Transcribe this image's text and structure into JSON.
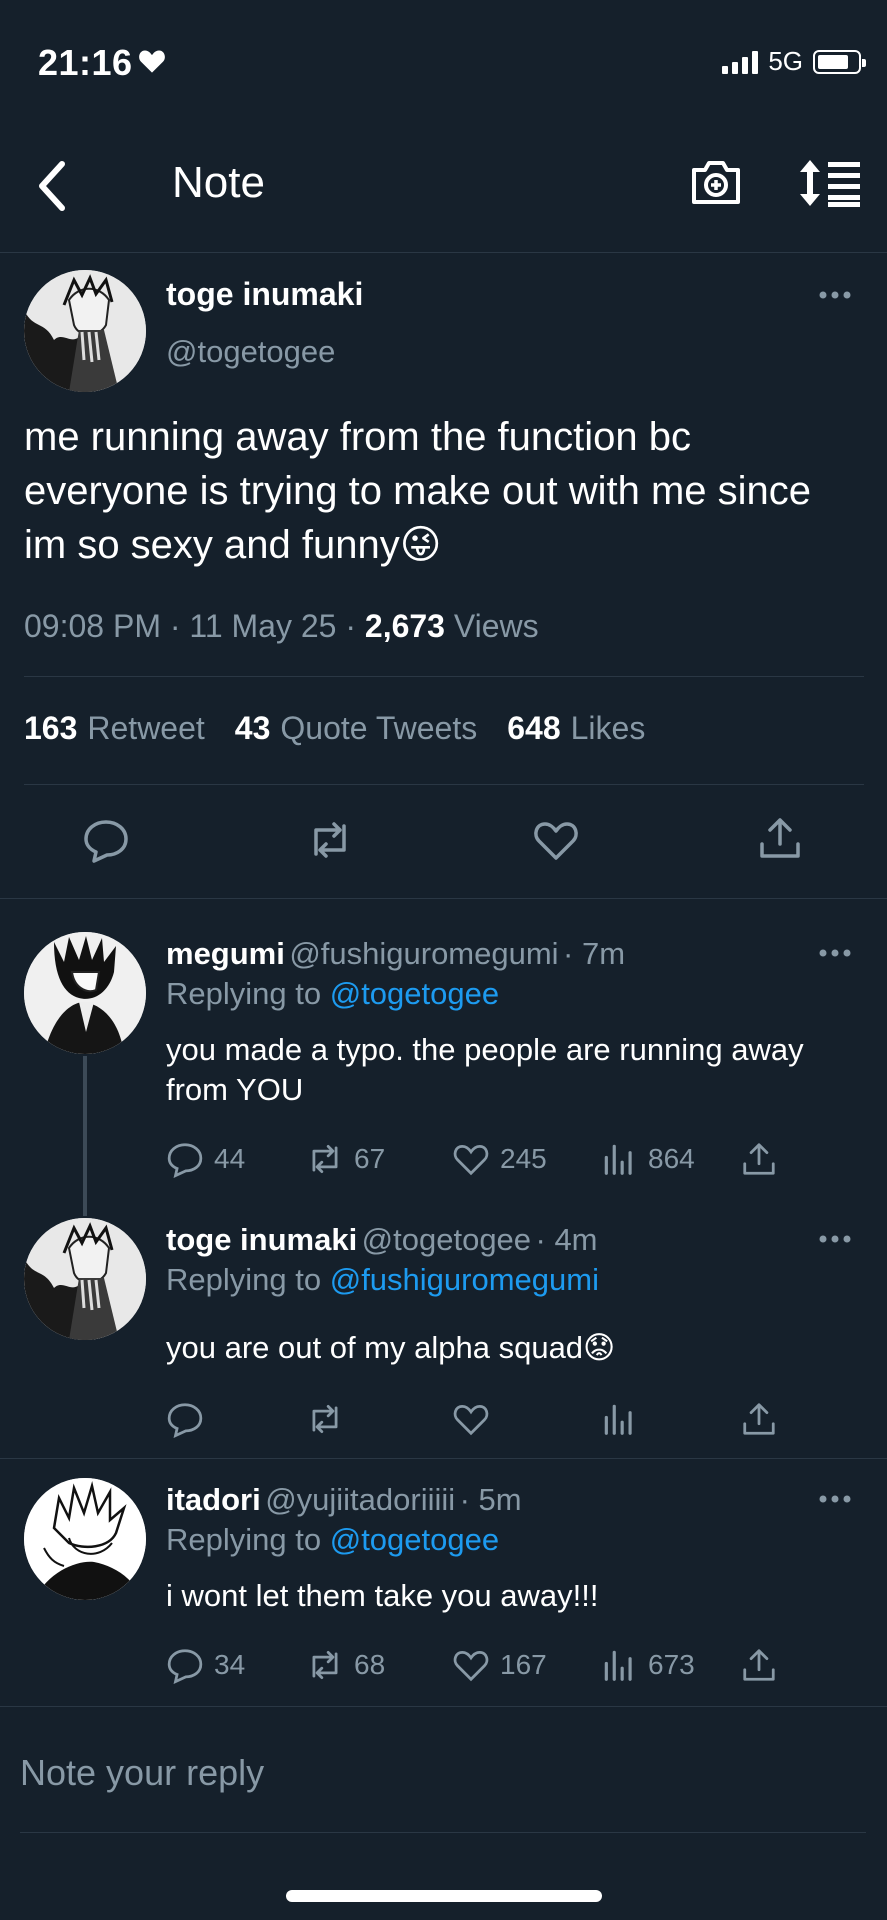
{
  "status_bar": {
    "time": "21:16",
    "network": "5G"
  },
  "header": {
    "title": "Note"
  },
  "main_tweet": {
    "name": "toge inumaki",
    "handle": "@togetogee",
    "text": "me running away from the function bc everyone is trying to make out with me since im so sexy and funny",
    "emoji": "😜",
    "time": "09:08 PM",
    "date": "11 May 25",
    "views_count": "2,673",
    "views_label": "Views",
    "retweets_count": "163",
    "retweets_label": "Retweet",
    "quotes_count": "43",
    "quotes_label": "Quote Tweets",
    "likes_count": "648",
    "likes_label": "Likes"
  },
  "replies": [
    {
      "name": "megumi",
      "handle": "@fushiguromegumi",
      "time": "7m",
      "replying_label": "Replying to",
      "replying_to": "@togetogee",
      "text": "you made a typo. the people are running away from YOU",
      "replies": "44",
      "retweets": "67",
      "likes": "245",
      "views": "864"
    },
    {
      "name": "toge inumaki",
      "handle": "@togetogee",
      "time": "4m",
      "replying_label": "Replying to",
      "replying_to": "@fushiguromegumi",
      "text": "you are out of my alpha squad",
      "emoji": "😟"
    },
    {
      "name": "itadori",
      "handle": "@yujiitadoriiiii",
      "time": "5m",
      "replying_label": "Replying to",
      "replying_to": "@togetogee",
      "text": "i wont let them take you away!!!",
      "replies": "34",
      "retweets": "68",
      "likes": "167",
      "views": "673"
    }
  ],
  "reply_box": {
    "placeholder": "Note your reply"
  },
  "colors": {
    "background": "#15202b",
    "accent": "#1d9bf0",
    "muted": "#8899a6",
    "divider": "#2a3744"
  },
  "icons": [
    "back-icon",
    "camera-icon",
    "sort-icon",
    "more-icon",
    "reply-icon",
    "retweet-icon",
    "like-icon",
    "views-icon",
    "share-icon"
  ]
}
